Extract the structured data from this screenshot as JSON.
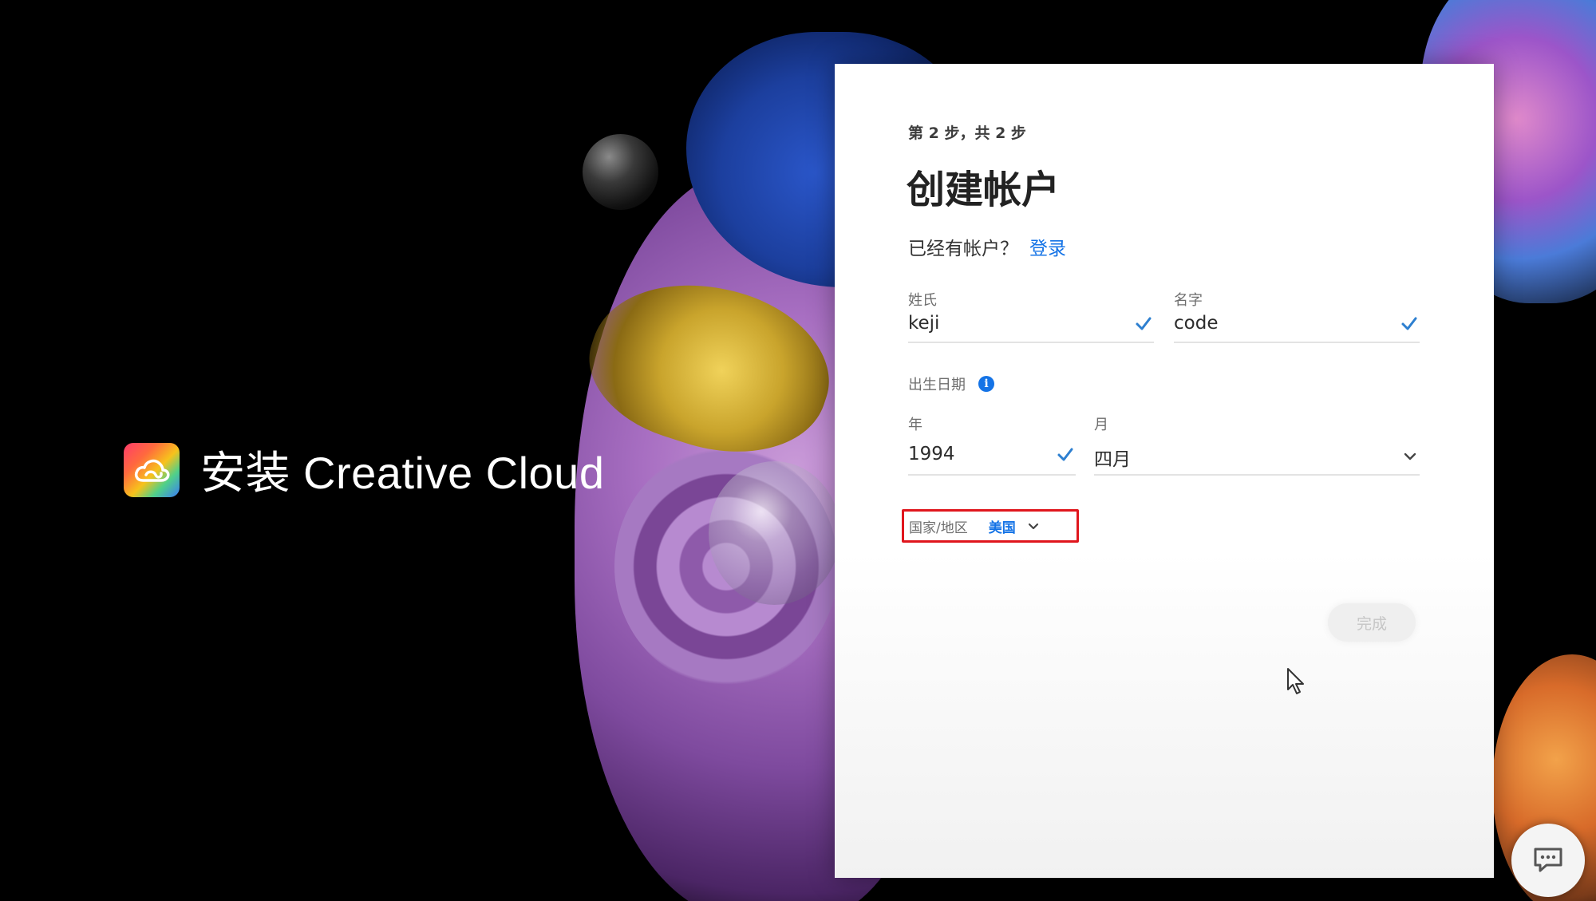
{
  "branding": {
    "title": "安装 Creative Cloud",
    "logo_icon": "creative-cloud-logo-icon"
  },
  "form": {
    "step": "第 2 步，共 2 步",
    "title": "创建帐户",
    "have_account": "已经有帐户？",
    "signin_link": "登录",
    "last_name": {
      "label": "姓氏",
      "value": "keji",
      "valid": true
    },
    "first_name": {
      "label": "名字",
      "value": "code",
      "valid": true
    },
    "dob": {
      "label": "出生日期",
      "info_icon": "info-icon",
      "year": {
        "label": "年",
        "value": "1994",
        "valid": true
      },
      "month": {
        "label": "月",
        "value": "四月"
      }
    },
    "country": {
      "label": "国家/地区",
      "value": "美国",
      "highlighted": true,
      "highlight_color": "#e0161d"
    },
    "done_button": "完成"
  },
  "colors": {
    "accent": "#1473e6",
    "check": "#2d7fd0",
    "highlight": "#e0161d"
  },
  "chat_icon": "chat-icon"
}
